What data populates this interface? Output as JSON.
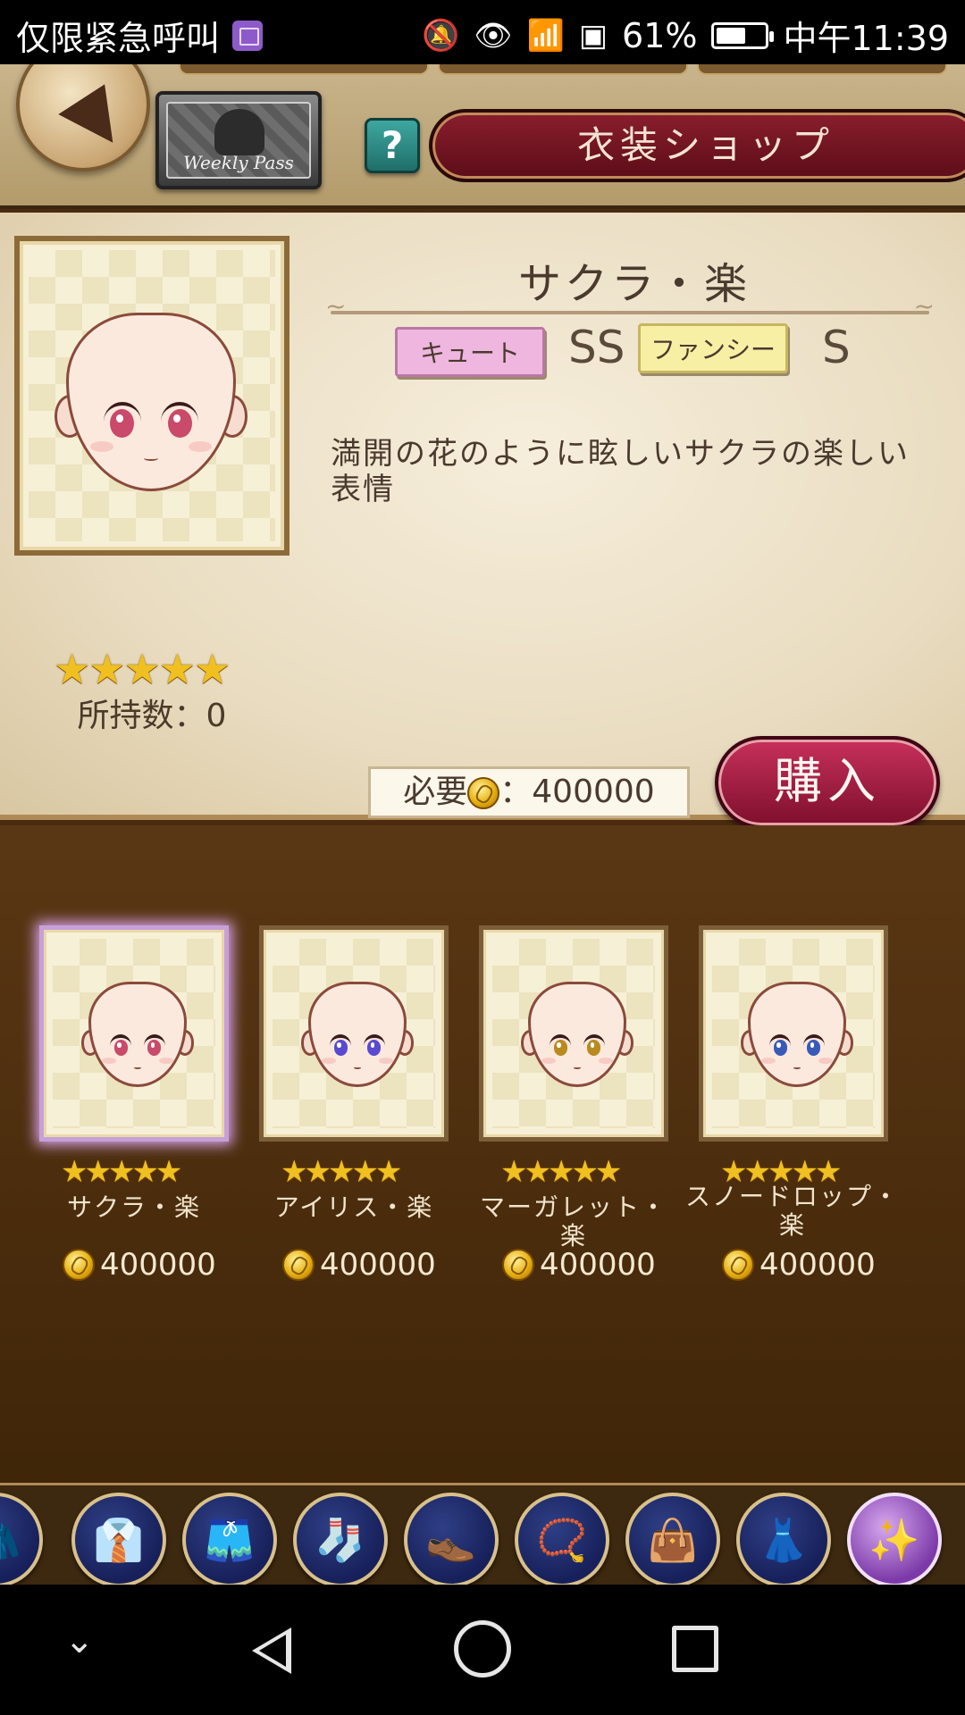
{
  "status_bar": {
    "carrier_text": "仅限紧急呼叫",
    "battery": "61%",
    "battery_level": 0.61,
    "time": "中午11:39"
  },
  "header": {
    "weekly_pass_label": "Weekly Pass",
    "help_label": "?",
    "title": "衣装ショップ"
  },
  "detail": {
    "name": "サクラ・楽",
    "tags": [
      {
        "label": "キュート",
        "rank": "SS",
        "color": "#efb6df"
      },
      {
        "label": "ファンシー",
        "rank": "S",
        "color": "#f7efa4"
      }
    ],
    "rarity_stars": "★★★★★",
    "owned": "所持数：0",
    "description": "満開の花のように眩しいサクラの楽しい表情",
    "cost_label": "必要",
    "cost_value": "：400000",
    "buy_label": "購入"
  },
  "items": [
    {
      "name": "サクラ・楽",
      "stars": "★★★★★",
      "price": "400000",
      "eye_color": "#c94a6a",
      "selected": true
    },
    {
      "name": "アイリス・楽",
      "stars": "★★★★★",
      "price": "400000",
      "eye_color": "#5a4ad0",
      "selected": false
    },
    {
      "name": "マーガレット・楽",
      "stars": "★★★★★",
      "price": "400000",
      "eye_color": "#b88a20",
      "selected": false
    },
    {
      "name": "スノードロップ・楽",
      "stars": "★★★★★",
      "price": "400000",
      "eye_color": "#3a5ab8",
      "selected": false
    }
  ],
  "tabs": [
    {
      "icon": "coat-icon",
      "glyph": "🧥"
    },
    {
      "icon": "shirt-icon",
      "glyph": "👔"
    },
    {
      "icon": "skirt-icon",
      "glyph": "🩳"
    },
    {
      "icon": "socks-icon",
      "glyph": "🧦"
    },
    {
      "icon": "shoes-icon",
      "glyph": "👞"
    },
    {
      "icon": "necklace-icon",
      "glyph": "📿"
    },
    {
      "icon": "bag-icon",
      "glyph": "👜"
    },
    {
      "icon": "dress-form-icon",
      "glyph": "👗"
    },
    {
      "icon": "makeup-icon",
      "glyph": "✨"
    }
  ],
  "navbar": {
    "down_glyph": "⌄"
  }
}
